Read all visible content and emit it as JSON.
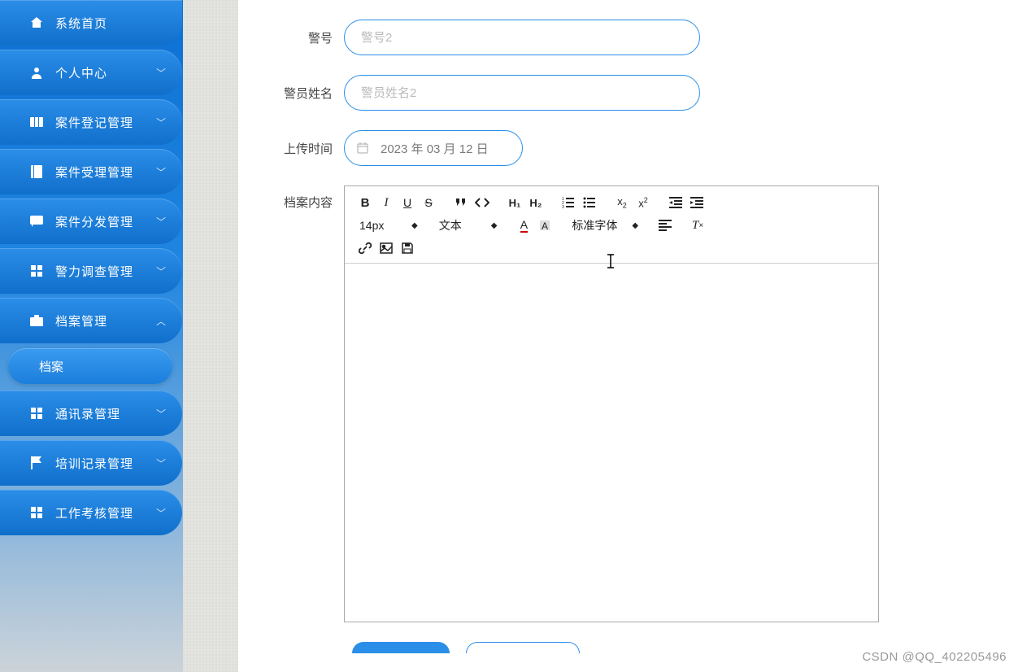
{
  "sidebar": {
    "items": [
      {
        "label": "系统首页",
        "icon": "home-icon",
        "chevron": false
      },
      {
        "label": "个人中心",
        "icon": "user-icon",
        "chevron": true
      },
      {
        "label": "案件登记管理",
        "icon": "ticket-icon",
        "chevron": true
      },
      {
        "label": "案件受理管理",
        "icon": "book-icon",
        "chevron": true
      },
      {
        "label": "案件分发管理",
        "icon": "chat-icon",
        "chevron": true
      },
      {
        "label": "警力调查管理",
        "icon": "grid-icon",
        "chevron": true
      },
      {
        "label": "档案管理",
        "icon": "briefcase-icon",
        "chevron": true,
        "expanded": true,
        "children": [
          {
            "label": "档案"
          }
        ]
      },
      {
        "label": "通讯录管理",
        "icon": "grid-icon",
        "chevron": true
      },
      {
        "label": "培训记录管理",
        "icon": "flag-icon",
        "chevron": true
      },
      {
        "label": "工作考核管理",
        "icon": "grid-icon",
        "chevron": true
      }
    ]
  },
  "form": {
    "badge_no": {
      "label": "警号",
      "placeholder": "警号2",
      "value": ""
    },
    "officer_name": {
      "label": "警员姓名",
      "placeholder": "警员姓名2",
      "value": ""
    },
    "upload_time": {
      "label": "上传时间",
      "value": "2023 年 03 月 12 日"
    },
    "content": {
      "label": "档案内容"
    }
  },
  "editor_toolbar": {
    "font_size": {
      "selected": "14px"
    },
    "block": {
      "selected": "文本"
    },
    "font_family": {
      "selected": "标准字体"
    }
  },
  "watermark": "CSDN @QQ_402205496"
}
